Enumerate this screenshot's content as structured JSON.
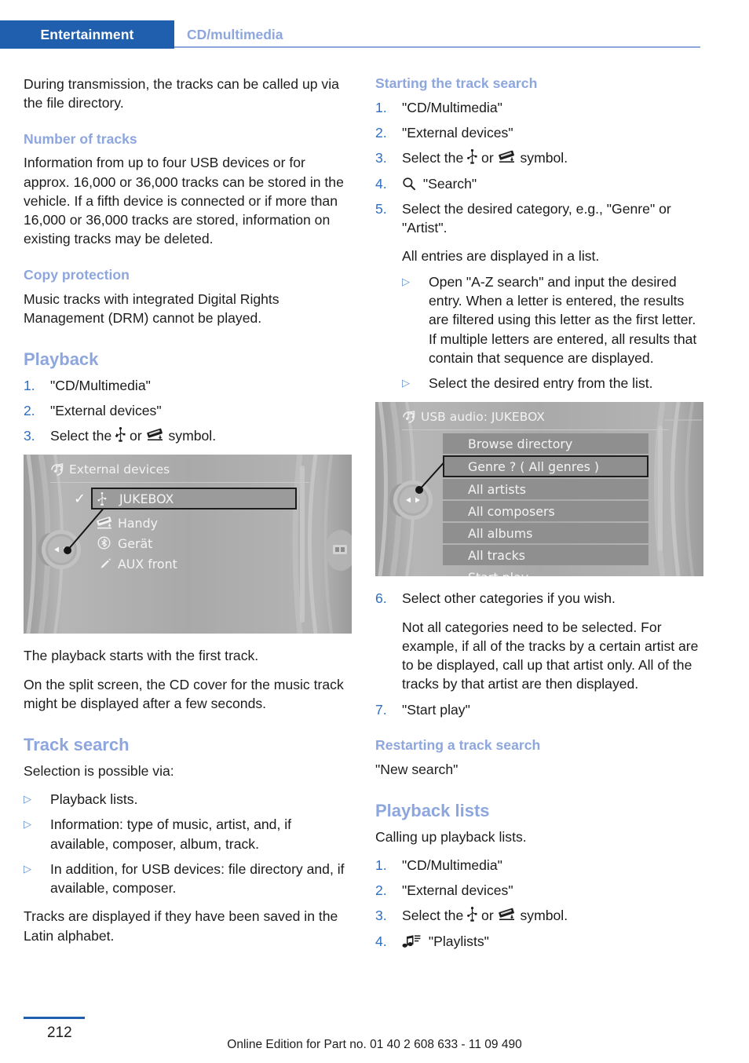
{
  "header": {
    "active_tab": "Entertainment",
    "section": "CD/multimedia",
    "accent_blue": "#1f5fad",
    "heading_blue": "#8da6dd"
  },
  "left_column": {
    "intro": "During transmission, the tracks can be called up via the file directory.",
    "number_of_tracks": {
      "heading": "Number of tracks",
      "body": "Information from up to four USB devices or for approx. 16,000 or 36,000 tracks can be stored in the vehicle. If a fifth device is connected or if more than 16,000 or 36,000 tracks are stored, information on existing tracks may be deleted."
    },
    "copy_protection": {
      "heading": "Copy protection",
      "body": "Music tracks with integrated Digital Rights Management (DRM) cannot be played."
    },
    "playback": {
      "heading": "Playback",
      "steps": [
        {
          "num": "1.",
          "text": "\"CD/Multimedia\""
        },
        {
          "num": "2.",
          "text": "\"External devices\""
        },
        {
          "num": "3.",
          "text": "Select the",
          "icons": [
            "usb-icon",
            "media-device-icon"
          ],
          "text_mid": "or",
          "text_end": "symbol."
        }
      ],
      "after_image_1": "The playback starts with the first track.",
      "after_image_2": "On the split screen, the CD cover for the music track might be displayed after a few seconds."
    },
    "track_search": {
      "heading": "Track search",
      "intro": "Selection is possible via:",
      "bullets": [
        "Playback lists.",
        "Information: type of music, artist, and, if available, composer, album, track.",
        "In addition, for USB devices: file directory and, if available, composer."
      ],
      "outro": "Tracks are displayed if they have been saved in the Latin alphabet."
    },
    "screenshot": {
      "title": "External devices",
      "title_icon": "multimedia-icon",
      "items": [
        {
          "label": "JUKEBOX",
          "icon": "usb-icon",
          "selected": true,
          "checked": true
        },
        {
          "label": "Handy",
          "icon": "media-device-icon",
          "selected": false,
          "checked": false
        },
        {
          "label": "Gerät",
          "icon": "bluetooth-icon",
          "selected": false,
          "checked": false
        },
        {
          "label": "AUX front",
          "icon": "aux-plug-icon",
          "selected": false,
          "checked": false
        }
      ]
    }
  },
  "right_column": {
    "starting_track_search": {
      "heading": "Starting the track search",
      "steps": [
        {
          "num": "1.",
          "text": "\"CD/Multimedia\""
        },
        {
          "num": "2.",
          "text": "\"External devices\""
        },
        {
          "num": "3.",
          "text": "Select the",
          "text_mid": "or",
          "text_end": "symbol."
        },
        {
          "num": "4.",
          "text": "\"Search\"",
          "icon": "search-icon"
        },
        {
          "num": "5.",
          "text": "Select the desired category, e.g., \"Genre\" or \"Artist\"."
        }
      ],
      "note": "All entries are displayed in a list.",
      "sub_bullets": [
        "Open \"A-Z search\" and input the desired entry. When a letter is entered, the results are filtered using this letter as the first letter. If multiple letters are entered, all results that contain that sequence are displayed.",
        "Select the desired entry from the list."
      ],
      "steps_after": [
        {
          "num": "6.",
          "text": "Select other categories if you wish."
        },
        {
          "num": "7.",
          "text": "\"Start play\""
        }
      ],
      "step6_note": "Not all categories need to be selected. For example, if all of the tracks by a certain artist are to be displayed, call up that artist only. All of the tracks by that artist are then displayed."
    },
    "restarting": {
      "heading": "Restarting a track search",
      "body": "\"New search\""
    },
    "playback_lists": {
      "heading": "Playback lists",
      "body": "Calling up playback lists.",
      "steps": [
        {
          "num": "1.",
          "text": "\"CD/Multimedia\""
        },
        {
          "num": "2.",
          "text": "\"External devices\""
        },
        {
          "num": "3.",
          "text": "Select the",
          "text_mid": "or",
          "text_end": "symbol."
        },
        {
          "num": "4.",
          "text": "\"Playlists\"",
          "icon": "playlist-icon"
        }
      ]
    },
    "screenshot": {
      "title": "USB audio: JUKEBOX",
      "title_icon": "multimedia-icon",
      "items": [
        {
          "label": "Browse directory",
          "selected": false,
          "plate": true
        },
        {
          "label": "Genre ? ( All genres )",
          "selected": true,
          "plate": true
        },
        {
          "label": "All artists",
          "selected": false,
          "plate": true
        },
        {
          "label": "All composers",
          "selected": false,
          "plate": true
        },
        {
          "label": "All albums",
          "selected": false,
          "plate": true
        },
        {
          "label": "All tracks",
          "selected": false,
          "plate": true
        },
        {
          "label": "Start play",
          "selected": false,
          "plate": false
        }
      ]
    }
  },
  "footer": {
    "page_number": "212",
    "note": "Online Edition for Part no. 01 40 2 608 633 - 11 09 490"
  }
}
